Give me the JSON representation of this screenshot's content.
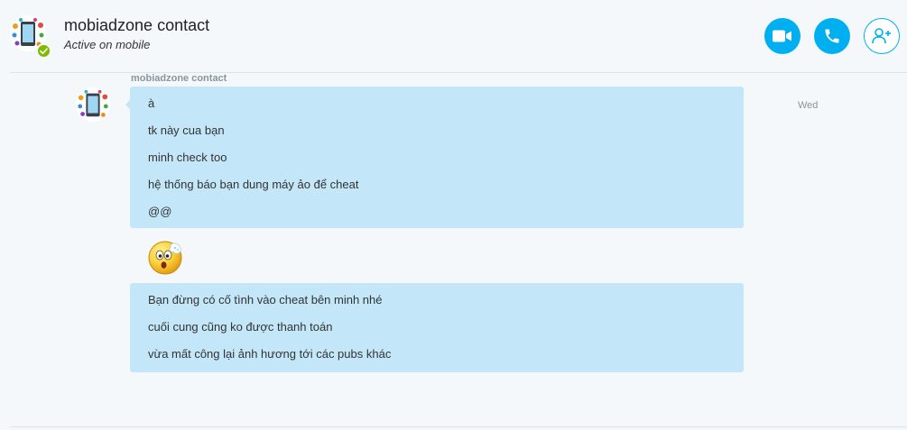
{
  "conversation": {
    "contact_name": "mobiadzone contact",
    "status_text": "Active on mobile",
    "presence": "online"
  },
  "actions": {
    "video_call_icon": "video-camera-icon",
    "audio_call_icon": "phone-icon",
    "add_people_icon": "add-person-icon"
  },
  "colors": {
    "accent": "#00aff0",
    "bubble": "#c3e7f8",
    "presence_online": "#7fba00",
    "background": "#f4f8fb"
  },
  "messages": {
    "group_sender": "mobiadzone contact",
    "timestamp": "Wed",
    "bubble_1": [
      "à",
      "tk này cua bạn",
      "minh check too",
      "hệ thống báo bạn dung máy ảo để cheat",
      "@@"
    ],
    "emoticon": "surprised-smiley-icon",
    "bubble_2": [
      "Bạn đừng có cố tình vào cheat bên minh nhé",
      "cuối cung cũng ko được thanh toán",
      "vừa mất công lại ảnh hương tới các pubs khác"
    ]
  }
}
